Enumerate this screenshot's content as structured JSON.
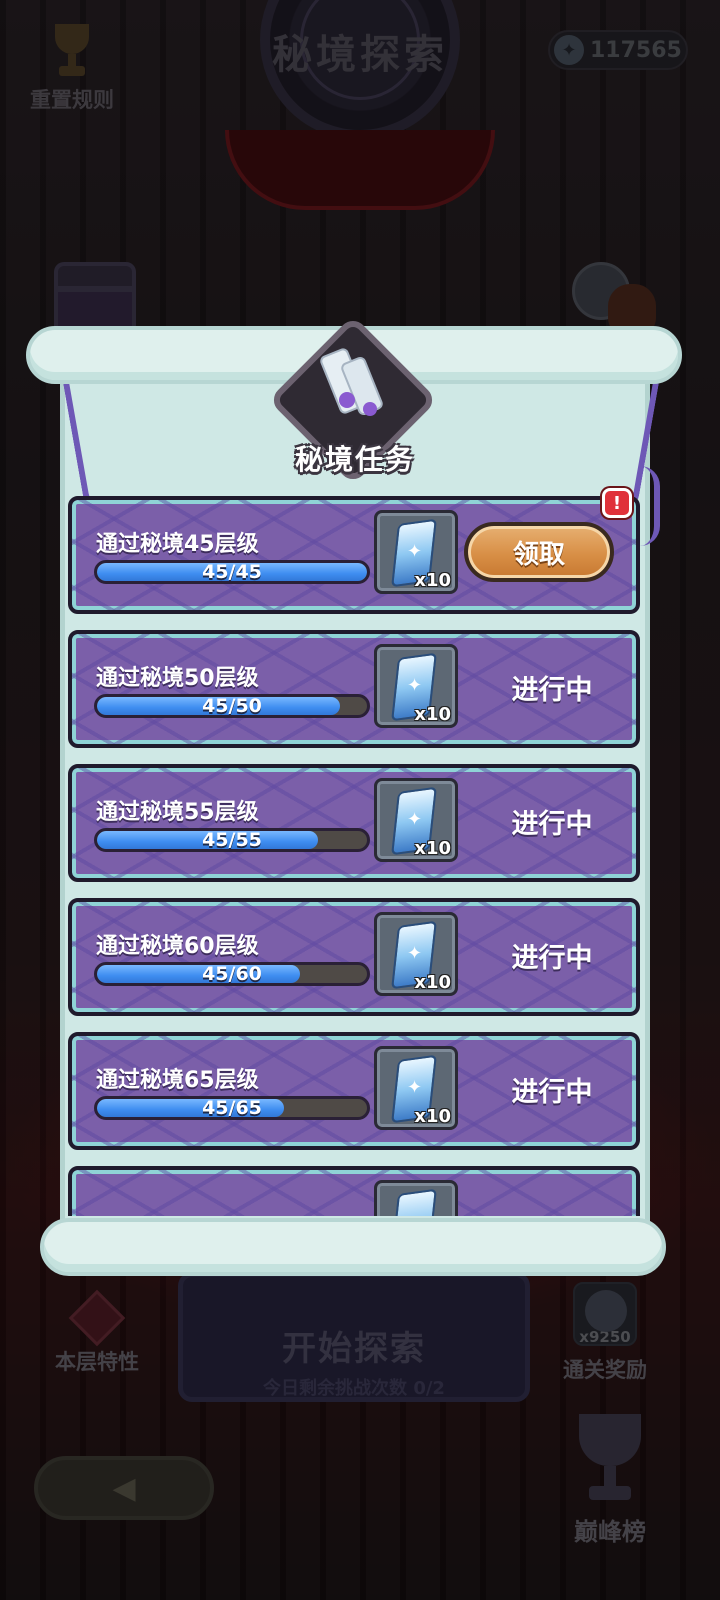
{
  "header": {
    "title": "秘境探索",
    "reset_rules_label": "重置规则",
    "currency_value": "117565"
  },
  "panel": {
    "title": "秘境任务",
    "tasks": [
      {
        "name": "通过秘境45层级",
        "progress_text": "45/45",
        "progress": 1.0,
        "reward_qty": "x10",
        "status": "领取",
        "claimable": true
      },
      {
        "name": "通过秘境50层级",
        "progress_text": "45/50",
        "progress": 0.9,
        "reward_qty": "x10",
        "status": "进行中",
        "claimable": false
      },
      {
        "name": "通过秘境55层级",
        "progress_text": "45/55",
        "progress": 0.818,
        "reward_qty": "x10",
        "status": "进行中",
        "claimable": false
      },
      {
        "name": "通过秘境60层级",
        "progress_text": "45/60",
        "progress": 0.75,
        "reward_qty": "x10",
        "status": "进行中",
        "claimable": false
      },
      {
        "name": "通过秘境65层级",
        "progress_text": "45/65",
        "progress": 0.692,
        "reward_qty": "x10",
        "status": "进行中",
        "claimable": false
      }
    ],
    "alert_mark": "!"
  },
  "footer": {
    "floor_trait_label": "本层特性",
    "start_label": "开始探索",
    "start_sub": "今日剩余挑战次数 0/2",
    "clear_reward_label": "通关奖励",
    "clear_reward_count": "x9250",
    "peak_rank_label": "巅峰榜"
  },
  "colors": {
    "card_purple": "#7b5fa9",
    "progress_blue": "#3e8df0",
    "claim_orange": "#d88f46",
    "scroll_mint": "#cfe8e5"
  }
}
